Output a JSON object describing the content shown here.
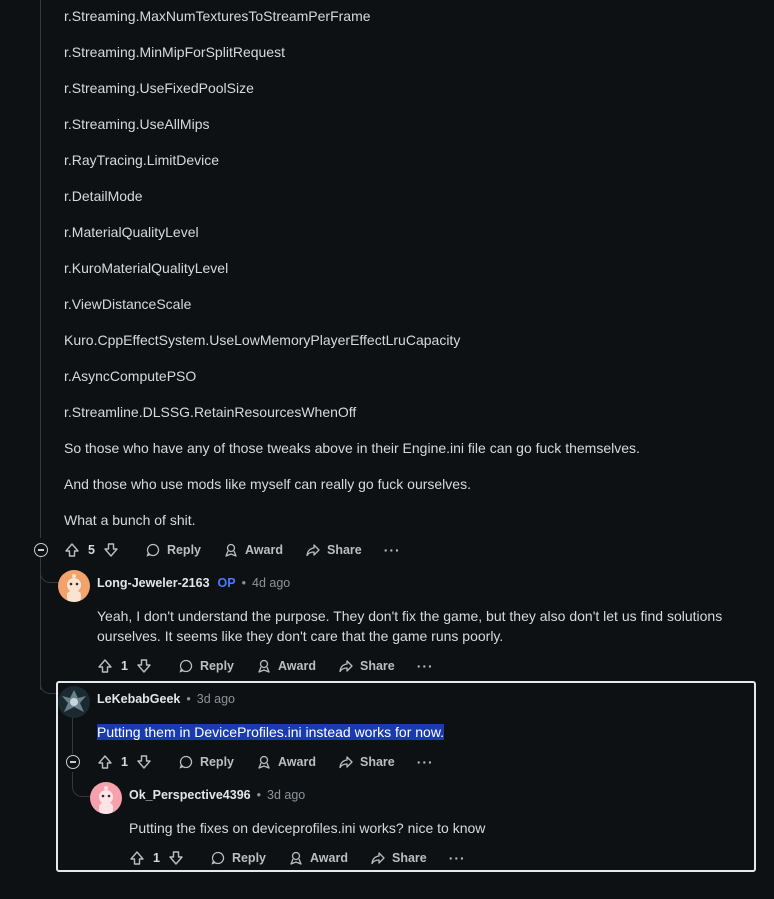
{
  "settings_lines": [
    "r.Streaming.MaxNumTexturesToStreamPerFrame",
    "r.Streaming.MinMipForSplitRequest",
    "r.Streaming.UseFixedPoolSize",
    "r.Streaming.UseAllMips",
    "r.RayTracing.LimitDevice",
    "r.DetailMode",
    "r.MaterialQualityLevel",
    "r.KuroMaterialQualityLevel",
    "r.ViewDistanceScale",
    "Kuro.CppEffectSystem.UseLowMemoryPlayerEffectLruCapacity",
    "r.AsyncComputePSO",
    "r.Streamline.DLSSG.RetainResourcesWhenOff",
    "So those who have any of those tweaks above in their Engine.ini file can go fuck themselves.",
    "And those who use mods like myself can really go fuck ourselves.",
    "What a bunch of shit."
  ],
  "actions": {
    "reply": "Reply",
    "award": "Award",
    "share": "Share",
    "more": "···"
  },
  "root_comment": {
    "votes": "5"
  },
  "comments": [
    {
      "author": "Long-Jeweler-2163",
      "badge": "OP",
      "time": "4d ago",
      "text_line1": "Yeah, I don't understand the purpose. They don't fix the game, but they also don't let us find solutions",
      "text_line2": "ourselves. It seems like they don't care that the game runs poorly.",
      "votes": "1",
      "avatar_color": "#f2a36b"
    },
    {
      "author": "LeKebabGeek",
      "time": "3d ago",
      "text": "Putting them in DeviceProfiles.ini instead works for now.",
      "votes": "1",
      "avatar_color": "#1b2a30"
    },
    {
      "author": "Ok_Perspective4396",
      "time": "3d ago",
      "text": "Putting the fixes on deviceprofiles.ini works? nice to know",
      "votes": "1",
      "avatar_color": "#f7a1ac"
    }
  ],
  "separator": "•",
  "icons": [
    "upvote-icon",
    "downvote-icon",
    "reply-bubble-icon",
    "award-icon",
    "share-arrow-icon",
    "collapse-minus-icon",
    "more-dots-icon"
  ]
}
